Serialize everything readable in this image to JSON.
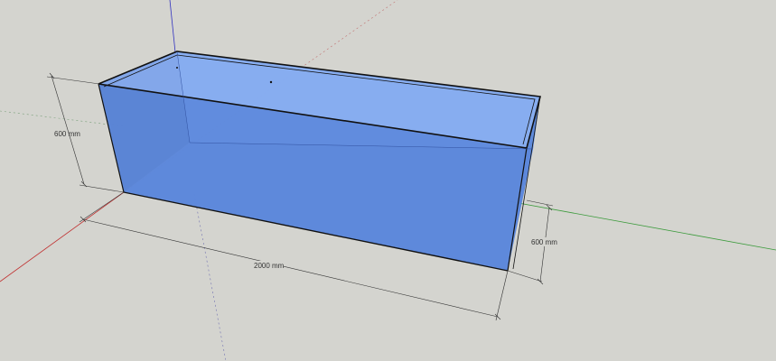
{
  "dimensions": {
    "height_left": "600 mm",
    "length": "2000 mm",
    "width_right": "600 mm"
  },
  "colors": {
    "background": "#d4d4cf",
    "glass_front": "#5b86d8",
    "glass_top": "#8aaef0",
    "glass_inner_back": "#6fa0f5",
    "edge": "#111111",
    "axis_red": "#c03030",
    "axis_green": "#3a9a3a",
    "axis_blue": "#3030c0",
    "dimension_line": "#333333"
  }
}
